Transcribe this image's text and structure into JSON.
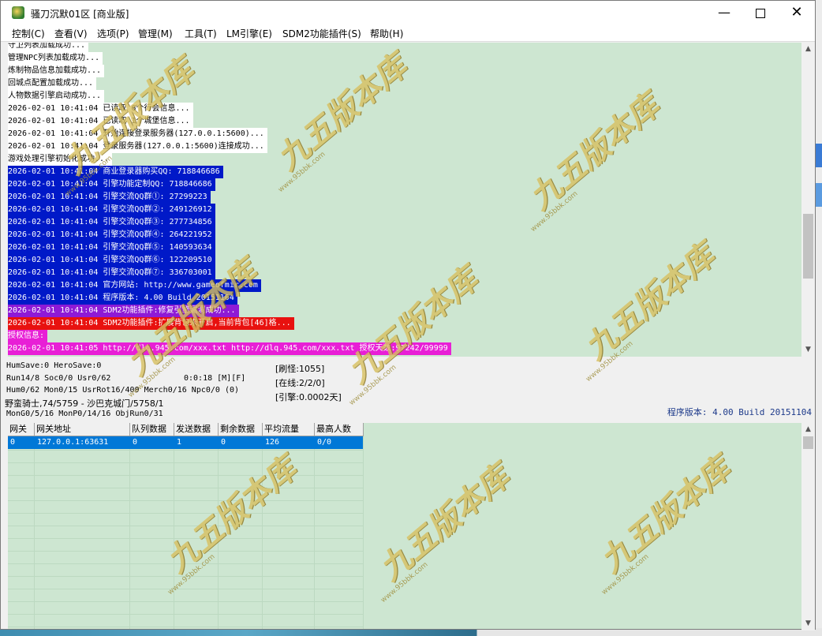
{
  "window": {
    "title": "骚刀沉默01区 [商业版]",
    "minimize_label": "—",
    "close_label": "✕"
  },
  "menu": [
    {
      "label": "控制(C)"
    },
    {
      "label": "查看(V)"
    },
    {
      "label": "选项(P)"
    },
    {
      "label": "管理(M)"
    },
    {
      "label": "工具(T)"
    },
    {
      "label": "LM引擎(E)"
    },
    {
      "label": "SDM2功能插件(S)"
    },
    {
      "label": "帮助(H)"
    }
  ],
  "log": [
    {
      "text": "守卫列表加载成功...",
      "style": "white"
    },
    {
      "text": "管理NPC列表加载成功...",
      "style": "white"
    },
    {
      "text": "炼制物品信息加载成功...",
      "style": "white"
    },
    {
      "text": "回城点配置加载成功...",
      "style": "white"
    },
    {
      "text": "人物数据引擎启动成功...",
      "style": "white"
    },
    {
      "text": "2026-02-01 10:41:04 已读取 6个行会信息...",
      "style": "white"
    },
    {
      "text": "2026-02-01 10:41:04 已读取 1个城堡信息...",
      "style": "white"
    },
    {
      "text": "2026-02-01 10:41:04 开始连接登录服务器(127.0.0.1:5600)...",
      "style": "white"
    },
    {
      "text": "2026-02-01 10:41:04 登录服务器(127.0.0.1:5600)连接成功...",
      "style": "white"
    },
    {
      "text": "游戏处理引擎初始化成功...",
      "style": "white"
    },
    {
      "text": "2026-02-01 10:41:04 商业登录器购买QQ: 718846686",
      "style": "blue"
    },
    {
      "text": "2026-02-01 10:41:04 引擎功能定制QQ: 718846686",
      "style": "blue"
    },
    {
      "text": "2026-02-01 10:41:04 引擎交流QQ群①: 27299223",
      "style": "blue"
    },
    {
      "text": "2026-02-01 10:41:04 引擎交流QQ群②: 249126912",
      "style": "blue"
    },
    {
      "text": "2026-02-01 10:41:04 引擎交流QQ群③: 277734856",
      "style": "blue"
    },
    {
      "text": "2026-02-01 10:41:04 引擎交流QQ群④: 264221952",
      "style": "blue"
    },
    {
      "text": "2026-02-01 10:41:04 引擎交流QQ群⑤: 140593634",
      "style": "blue"
    },
    {
      "text": "2026-02-01 10:41:04 引擎交流QQ群⑥: 122209510",
      "style": "blue"
    },
    {
      "text": "2026-02-01 10:41:04 引擎交流QQ群⑦: 336703001",
      "style": "blue"
    },
    {
      "text": "2026-02-01 10:41:04 官方网站: http://www.gameofmir.com",
      "style": "blue"
    },
    {
      "text": "2026-02-01 10:41:04 程序版本: 4.00 Build 20151104",
      "style": "blue"
    },
    {
      "text": "2026-02-01 10:41:04 SDM2功能插件:修复引擎漏洞成功...",
      "style": "purple"
    },
    {
      "text": "2026-02-01 10:41:04 SDM2功能插件:扩展背包未开启,当前背包[46]格...",
      "style": "red"
    },
    {
      "text": "授权信息:",
      "style": "magenta"
    },
    {
      "text": "2026-02-01 10:41:05 http://dlq.945.com/xxx.txt http://dlq.945.com/xxx.txt 授权天数:97242/99999",
      "style": "magenta"
    }
  ],
  "status": {
    "line1": "HumSave:0 HeroSave:0",
    "line2": "Run14/8 Soc0/0 Usr0/62",
    "line3": "Hum0/62 Mon0/15 UsrRot16/400 Merch0/16 Npc0/0 (0)",
    "line4": "野蛮骑士,74/5759 - 沙巴克城门/5758/1",
    "line5": "MonG0/5/16 MonP0/14/16 ObjRun0/31",
    "timer": "0:0:18 [M][F]",
    "refresh": "[刷怪:1055]",
    "online": "[在线:2/2/0]",
    "engine": "[引擎:0.0002天]",
    "version": "程序版本: 4.00 Build 20151104"
  },
  "gateway_table": {
    "columns": [
      "网关",
      "网关地址",
      "队列数据",
      "发送数据",
      "剩余数据",
      "平均流量",
      "最高人数"
    ],
    "rows": [
      [
        "0",
        "127.0.0.1:63631",
        "0",
        "1",
        "0",
        "126",
        "0/0"
      ]
    ]
  },
  "watermark": {
    "text": "九五版本库",
    "url": "www.95bbk.com"
  }
}
